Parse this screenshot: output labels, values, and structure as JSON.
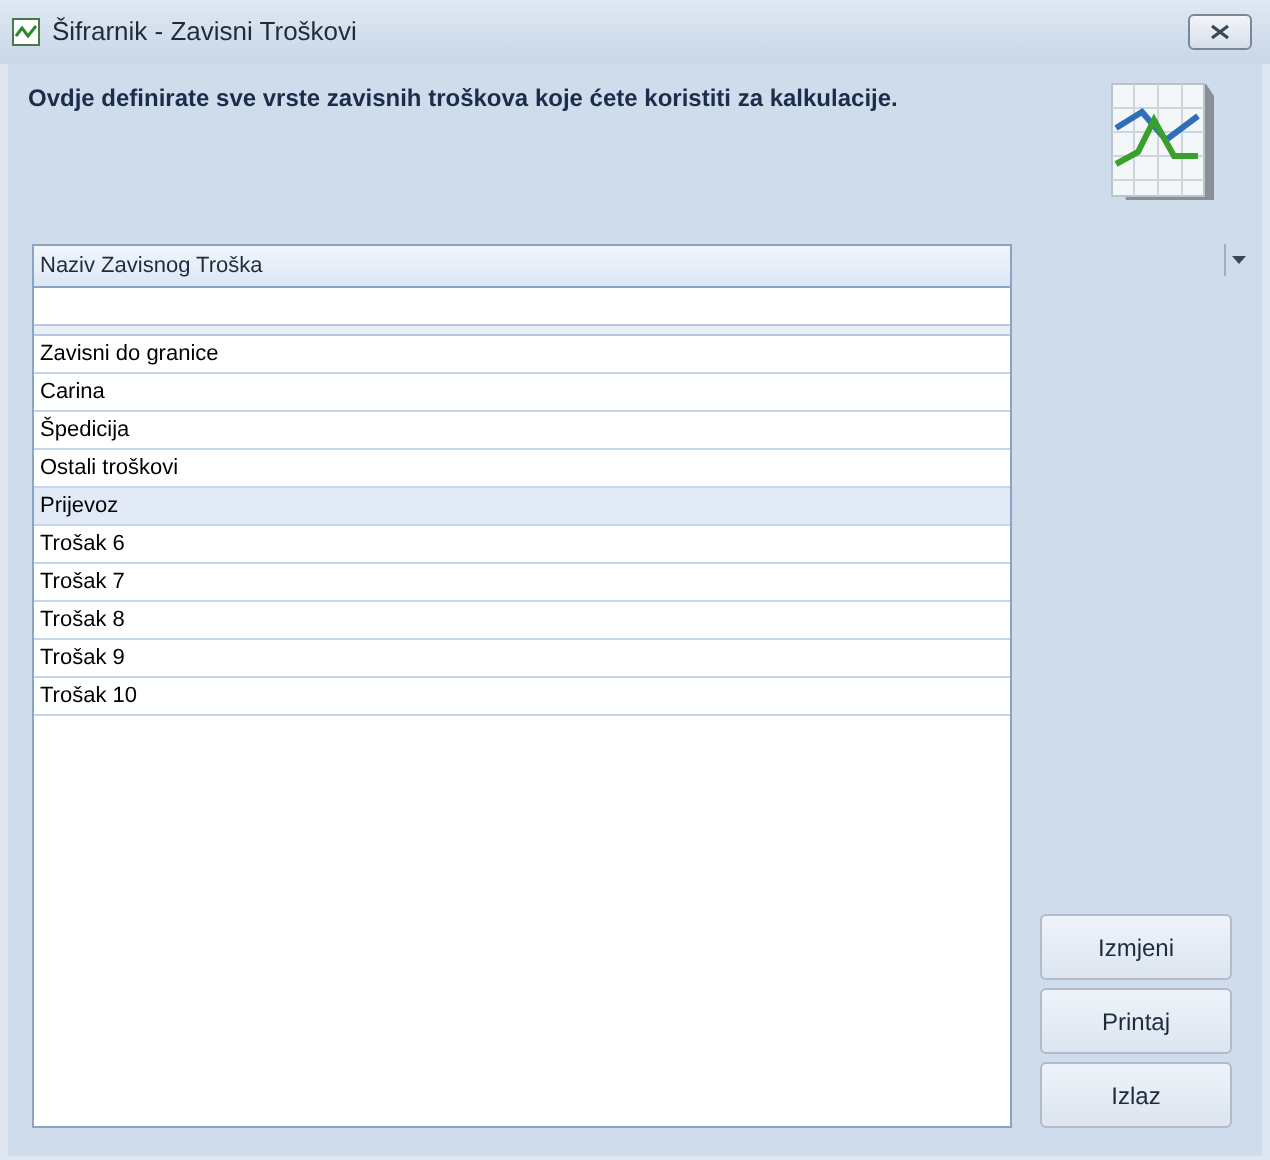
{
  "window": {
    "title": "Šifrarnik - Zavisni Troškovi"
  },
  "description": "Ovdje definirate sve vrste zavisnih troškova koje ćete koristiti za kalkulacije.",
  "table": {
    "columns": [
      "Naziv Zavisnog Troška"
    ],
    "rows": [
      {
        "name": "Zavisni do granice",
        "selected": false
      },
      {
        "name": "Carina",
        "selected": false
      },
      {
        "name": "Špedicija",
        "selected": false
      },
      {
        "name": "Ostali troškovi",
        "selected": false
      },
      {
        "name": "Prijevoz",
        "selected": true
      },
      {
        "name": "Trošak 6",
        "selected": false
      },
      {
        "name": "Trošak 7",
        "selected": false
      },
      {
        "name": "Trošak 8",
        "selected": false
      },
      {
        "name": "Trošak 9",
        "selected": false
      },
      {
        "name": "Trošak 10",
        "selected": false
      }
    ]
  },
  "buttons": [
    "Izmjeni",
    "Printaj",
    "Izlaz"
  ]
}
